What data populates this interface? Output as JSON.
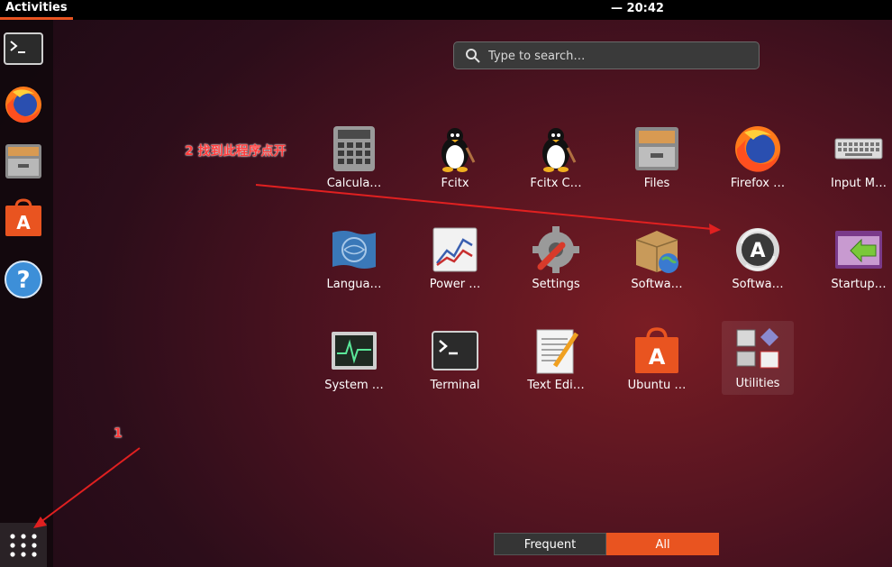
{
  "topbar": {
    "activities": "Activities",
    "clock": "— 20:42"
  },
  "dock": {
    "items": [
      {
        "name": "terminal-icon"
      },
      {
        "name": "firefox-icon"
      },
      {
        "name": "files-icon"
      },
      {
        "name": "software-center-icon"
      },
      {
        "name": "help-icon"
      }
    ],
    "show_apps_icon": "grid-icon"
  },
  "search": {
    "placeholder": "Type to search…"
  },
  "apps": [
    {
      "label": "Calcula…",
      "icon": "calculator-icon"
    },
    {
      "label": "Fcitx",
      "icon": "penguin-icon"
    },
    {
      "label": "Fcitx C…",
      "icon": "penguin-icon"
    },
    {
      "label": "Files",
      "icon": "files-icon"
    },
    {
      "label": "Firefox …",
      "icon": "firefox-icon"
    },
    {
      "label": "Input M…",
      "icon": "keyboard-icon"
    },
    {
      "label": "Langua…",
      "icon": "language-flag-icon"
    },
    {
      "label": "Power …",
      "icon": "power-statistics-icon"
    },
    {
      "label": "Settings",
      "icon": "settings-icon"
    },
    {
      "label": "Softwa…",
      "icon": "software-box-icon"
    },
    {
      "label": "Softwa…",
      "icon": "software-updater-icon"
    },
    {
      "label": "Startup…",
      "icon": "startup-icon"
    },
    {
      "label": "System …",
      "icon": "system-monitor-icon"
    },
    {
      "label": "Terminal",
      "icon": "terminal-icon"
    },
    {
      "label": "Text Edi…",
      "icon": "text-editor-icon"
    },
    {
      "label": "Ubuntu …",
      "icon": "ubuntu-software-icon"
    },
    {
      "label": "Utilities",
      "icon": "utilities-folder-icon"
    }
  ],
  "annotations": {
    "step1": "1",
    "step2": "2 找到此程序点开"
  },
  "annotation_color": "#ff3b3b",
  "tabs": {
    "frequent": "Frequent",
    "all": "All"
  },
  "colors": {
    "accent": "#e95420",
    "dock": "#10080c"
  }
}
